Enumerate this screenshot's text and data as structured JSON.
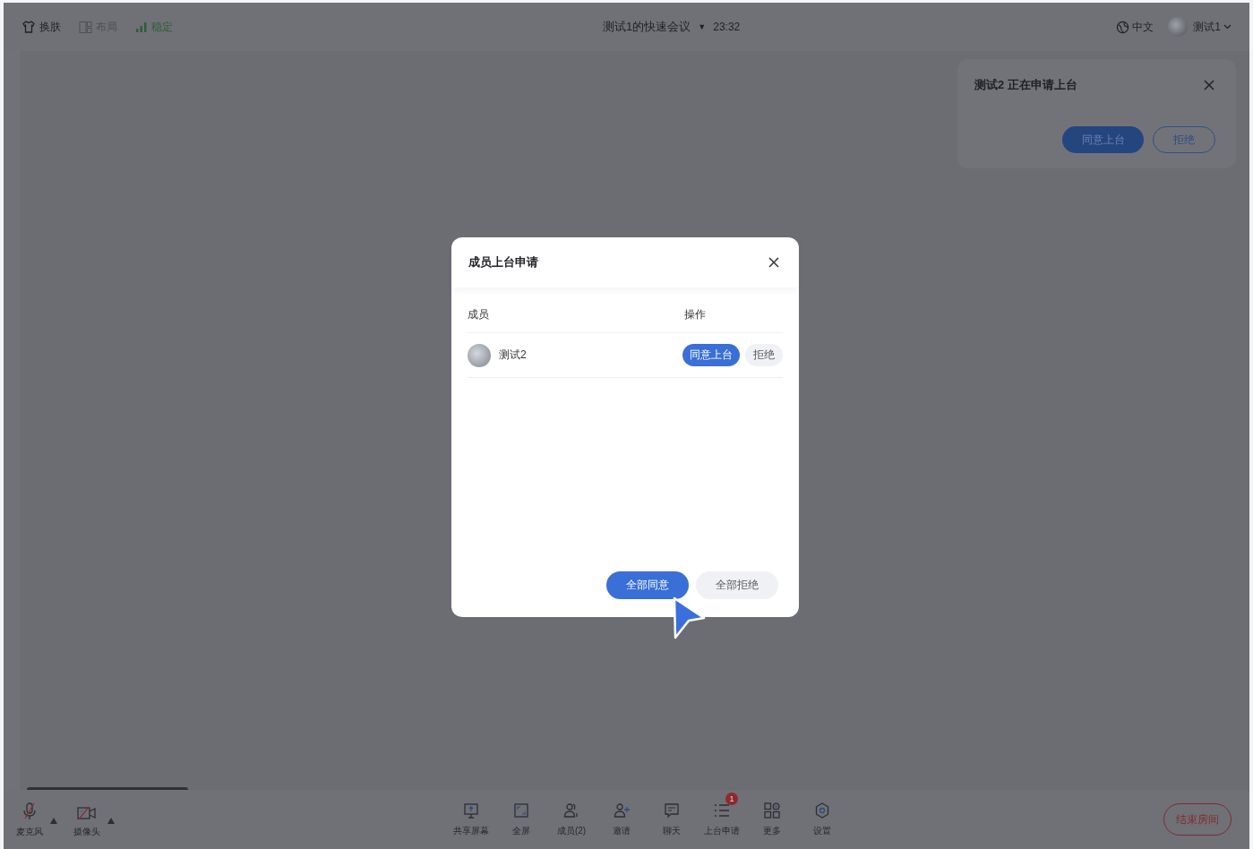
{
  "top_bar": {
    "left_items": [
      {
        "kind": "skin",
        "label": "换肤",
        "disabled": false
      },
      {
        "kind": "layout",
        "label": "布局",
        "disabled": true
      },
      {
        "kind": "signal",
        "label": "稳定",
        "disabled": false
      }
    ],
    "meeting_title": "测试1的快速会议",
    "title_caret": "▼",
    "time": "23:32",
    "language": "中文",
    "user_name": "测试1"
  },
  "notification": {
    "message": "测试2 正在申请上台",
    "accept": "同意上台",
    "reject": "拒绝"
  },
  "dialog": {
    "title": "成员上台申请",
    "columns": [
      "成员",
      "操作"
    ],
    "rows": [
      {
        "name": "测试2",
        "accept": "同意上台",
        "reject": "拒绝"
      }
    ],
    "accept_all": "全部同意",
    "reject_all": "全部拒绝"
  },
  "toolbar": {
    "devices": [
      {
        "kind": "microphone",
        "label": "麦克风",
        "muted": true
      },
      {
        "kind": "camera",
        "label": "摄像头",
        "muted": true
      }
    ],
    "items": [
      {
        "kind": "share",
        "label": "共享屏幕"
      },
      {
        "kind": "fullscreen",
        "label": "全屏"
      },
      {
        "kind": "members",
        "label": "成员(2)"
      },
      {
        "kind": "invite",
        "label": "邀请"
      },
      {
        "kind": "chat",
        "label": "聊天"
      },
      {
        "kind": "requests",
        "label": "上台申请",
        "badge": "1"
      },
      {
        "kind": "more",
        "label": "更多"
      },
      {
        "kind": "settings",
        "label": "设置"
      }
    ],
    "end_button": "结束房间"
  }
}
